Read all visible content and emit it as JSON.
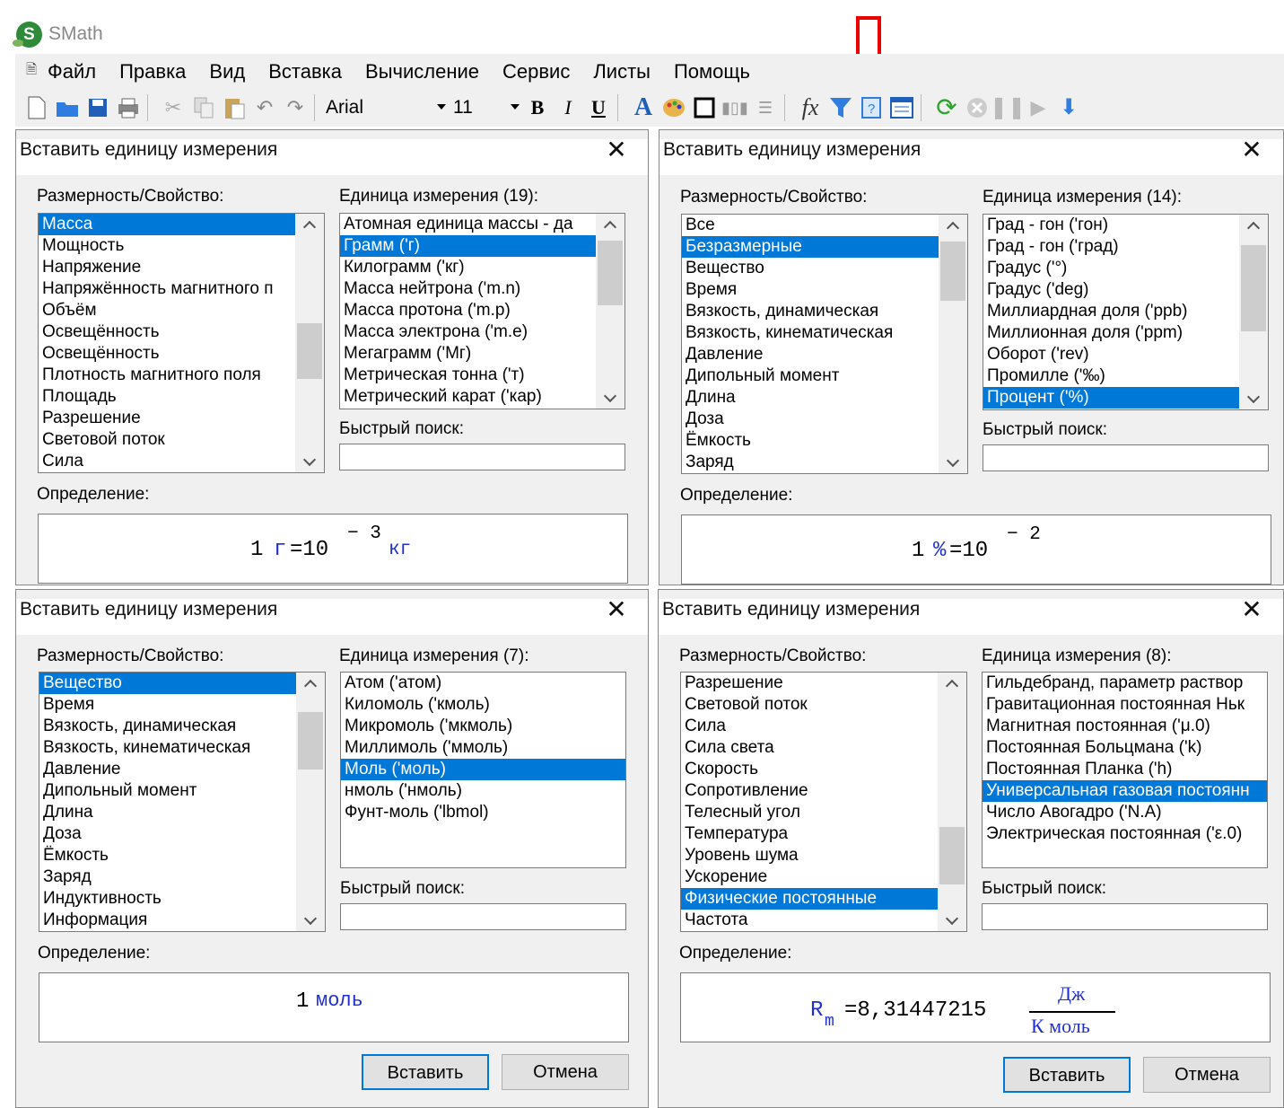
{
  "app": {
    "title": "SMath"
  },
  "menu": [
    "Файл",
    "Правка",
    "Вид",
    "Вставка",
    "Вычисление",
    "Сервис",
    "Листы",
    "Помощь"
  ],
  "toolbar": {
    "font": "Arial",
    "size": "11",
    "bold": "B",
    "italic": "I",
    "underline": "U",
    "fx": "fx"
  },
  "dialogs": [
    {
      "title": "Вставить единицу измерения",
      "dim_label": "Размерность/Свойство:",
      "unit_label": "Единица измерения (19):",
      "search_label": "Быстрый поиск:",
      "def_label": "Определение:",
      "dims": [
        "Масса",
        "Мощность",
        "Напряжение",
        "Напряжённость магнитного п",
        "Объём",
        "Освещённость",
        "Освещённость",
        "Плотность магнитного поля",
        "Площадь",
        "Разрешение",
        "Световой поток",
        "Сила"
      ],
      "dim_sel": 0,
      "units": [
        "Атомная единица массы - да",
        "Грамм ('г)",
        "Килограмм ('кг)",
        "Масса нейтрона ('m.n)",
        "Масса протона ('m.p)",
        "Масса электрона ('m.e)",
        "Мегаграмм ('Мг)",
        "Метрическая тонна ('т)",
        "Метрический карат ('кар)"
      ],
      "unit_sel": 1,
      "def": {
        "a": "1",
        "u1": "г",
        "eq": "=10",
        "exp": "− 3",
        "u2": "кг"
      }
    },
    {
      "title": "Вставить единицу измерения",
      "dim_label": "Размерность/Свойство:",
      "unit_label": "Единица измерения (14):",
      "search_label": "Быстрый поиск:",
      "def_label": "Определение:",
      "dims": [
        "Все",
        "Безразмерные",
        "Вещество",
        "Время",
        "Вязкость, динамическая",
        "Вязкость, кинематическая",
        "Давление",
        "Дипольный момент",
        "Длина",
        "Доза",
        "Ёмкость",
        "Заряд"
      ],
      "dim_sel": 1,
      "units": [
        "Град - гон ('гон)",
        "Град - гон ('град)",
        "Градус ('°)",
        "Градус ('deg)",
        "Миллиардная доля ('ppb)",
        "Миллионная доля ('ppm)",
        "Оборот ('rev)",
        "Промилле ('‰)",
        "Процент ('%)"
      ],
      "unit_sel": 8,
      "def": {
        "a": "1",
        "u1": "%",
        "eq": "=10",
        "exp": "− 2"
      }
    },
    {
      "title": "Вставить единицу измерения",
      "dim_label": "Размерность/Свойство:",
      "unit_label": "Единица измерения (7):",
      "search_label": "Быстрый поиск:",
      "def_label": "Определение:",
      "dims": [
        "Вещество",
        "Время",
        "Вязкость, динамическая",
        "Вязкость, кинематическая",
        "Давление",
        "Дипольный момент",
        "Длина",
        "Доза",
        "Ёмкость",
        "Заряд",
        "Индуктивность",
        "Информация"
      ],
      "dim_sel": 0,
      "units": [
        "Атом ('атом)",
        "Киломоль ('кмоль)",
        "Микромоль ('мкмоль)",
        "Миллимоль ('ммоль)",
        "Моль ('моль)",
        "нмоль ('нмоль)",
        "Фунт-моль ('lbmol)"
      ],
      "unit_sel": 4,
      "def": {
        "a": "1",
        "u1": "моль"
      },
      "insert": "Вставить",
      "cancel": "Отмена"
    },
    {
      "title": "Вставить единицу измерения",
      "dim_label": "Размерность/Свойство:",
      "unit_label": "Единица измерения (8):",
      "search_label": "Быстрый поиск:",
      "def_label": "Определение:",
      "dims": [
        "Разрешение",
        "Световой поток",
        "Сила",
        "Сила света",
        "Скорость",
        "Сопротивление",
        "Телесный угол",
        "Температура",
        "Уровень шума",
        "Ускорение",
        "Физические постоянные",
        "Частота"
      ],
      "dim_sel": 10,
      "units": [
        "Гильдебранд, параметр раствор",
        "Гравитационная постоянная Ньк",
        "Магнитная постоянная ('μ.0)",
        "Постоянная Больцмана ('k)",
        "Постоянная Планка ('h)",
        "Универсальная газовая постоянн",
        "Число Авогадро ('N.A)",
        "Электрическая постоянная ('ε.0)"
      ],
      "unit_sel": 5,
      "def": {
        "sym": "R",
        "sub": "m",
        "eq": "=8,31447215",
        "num": "Дж",
        "den": "К моль"
      },
      "insert": "Вставить",
      "cancel": "Отмена"
    }
  ]
}
